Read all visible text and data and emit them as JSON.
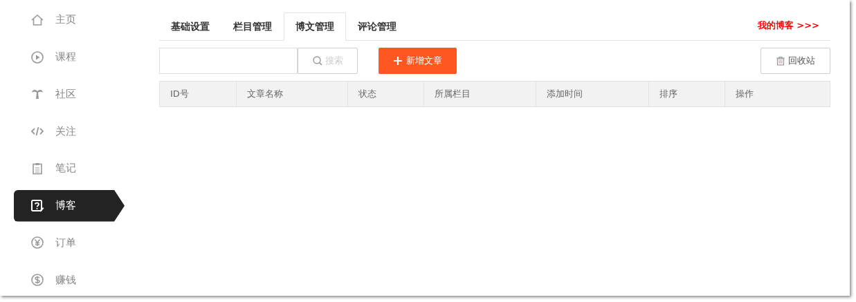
{
  "sidebar": {
    "items": [
      {
        "label": "主页",
        "selected": false
      },
      {
        "label": "课程",
        "selected": false
      },
      {
        "label": "社区",
        "selected": false
      },
      {
        "label": "关注",
        "selected": false
      },
      {
        "label": "笔记",
        "selected": false
      },
      {
        "label": "博客",
        "selected": true
      },
      {
        "label": "订单",
        "selected": false
      },
      {
        "label": "赚钱",
        "selected": false
      }
    ]
  },
  "tabs": [
    {
      "label": "基础设置",
      "selected": false
    },
    {
      "label": "栏目管理",
      "selected": false
    },
    {
      "label": "博文管理",
      "selected": true
    },
    {
      "label": "评论管理",
      "selected": false
    }
  ],
  "my_blog_link": "我的博客 >>>",
  "toolbar": {
    "search_button": "搜索",
    "add_button": "新增文章",
    "recycle_button": "回收站"
  },
  "table": {
    "columns": [
      "ID号",
      "文章名称",
      "状态",
      "所属栏目",
      "添加时间",
      "排序",
      "操作"
    ]
  }
}
